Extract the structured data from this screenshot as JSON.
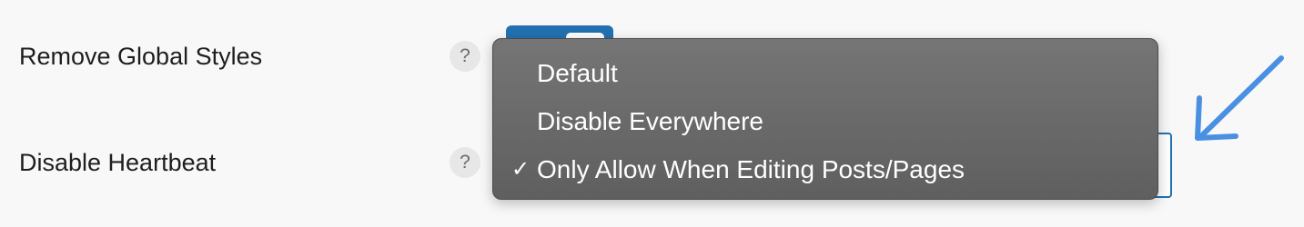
{
  "settings": {
    "rows": [
      {
        "label": "Remove Global Styles",
        "help": "?"
      },
      {
        "label": "Disable Heartbeat",
        "help": "?"
      }
    ]
  },
  "dropdown": {
    "options": [
      {
        "label": "Default",
        "selected": false
      },
      {
        "label": "Disable Everywhere",
        "selected": false
      },
      {
        "label": "Only Allow When Editing Posts/Pages",
        "selected": true
      }
    ],
    "check_mark": "✓"
  },
  "colors": {
    "accent": "#2271b1",
    "arrow": "#4a90e2",
    "dropdown_bg": "#6a6a6a"
  },
  "icons": {
    "help": "question-mark-icon",
    "check": "checkmark-icon",
    "annotation": "arrow-annotation-icon"
  }
}
